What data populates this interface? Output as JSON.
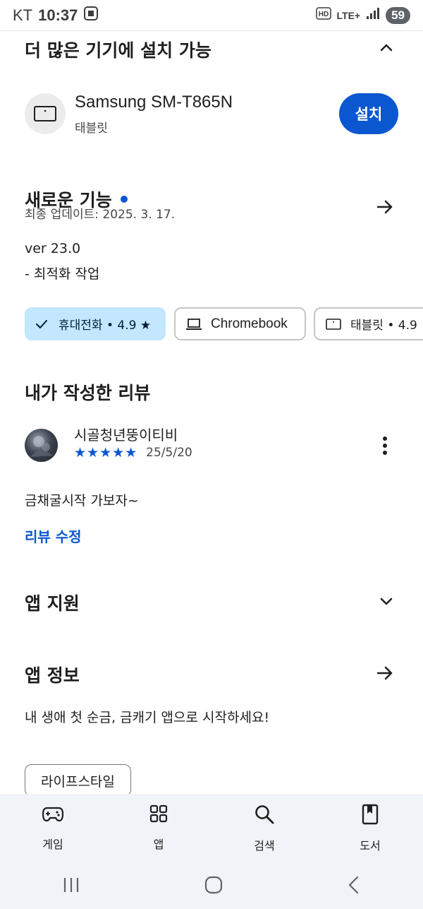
{
  "status_bar": {
    "carrier": "KT",
    "time": "10:37",
    "network": "LTE+",
    "battery": "59"
  },
  "more_devices": {
    "title": "더 많은 기기에 설치 가능",
    "device_name": "Samsung SM-T865N",
    "device_type": "태블릿",
    "install_label": "설치"
  },
  "whats_new": {
    "title": "새로운 기능",
    "last_updated": "최종 업데이트: 2025. 3. 17.",
    "version": "ver 23.0",
    "notes": "- 최적화 작업"
  },
  "device_chips": [
    {
      "label": "휴대전화 • 4.9 ★",
      "selected": true,
      "icon": "check-icon"
    },
    {
      "label": "Chromebook",
      "selected": false,
      "icon": "laptop-icon"
    },
    {
      "label": "태블릿 • 4.9",
      "selected": false,
      "icon": "tablet-icon"
    }
  ],
  "my_review": {
    "title": "내가 작성한 리뷰",
    "author": "시골청년뚱이티비",
    "rating": 5,
    "stars": "★★★★★",
    "date": "25/5/20",
    "text": "금채굴시작 가보자~",
    "edit_label": "리뷰 수정"
  },
  "app_support": {
    "title": "앱 지원"
  },
  "app_info": {
    "title": "앱 정보",
    "description": "내 생애 첫 순금, 금캐기 앱으로 시작하세요!",
    "category": "라이프스타일"
  },
  "bottom_nav": [
    {
      "label": "게임",
      "icon": "gamepad-icon"
    },
    {
      "label": "앱",
      "icon": "apps-grid-icon"
    },
    {
      "label": "검색",
      "icon": "search-icon"
    },
    {
      "label": "도서",
      "icon": "book-icon"
    }
  ],
  "colors": {
    "accent": "#0b57d0",
    "chip_selected_bg": "#c2e7ff",
    "nav_bg": "#f0f4f9"
  }
}
